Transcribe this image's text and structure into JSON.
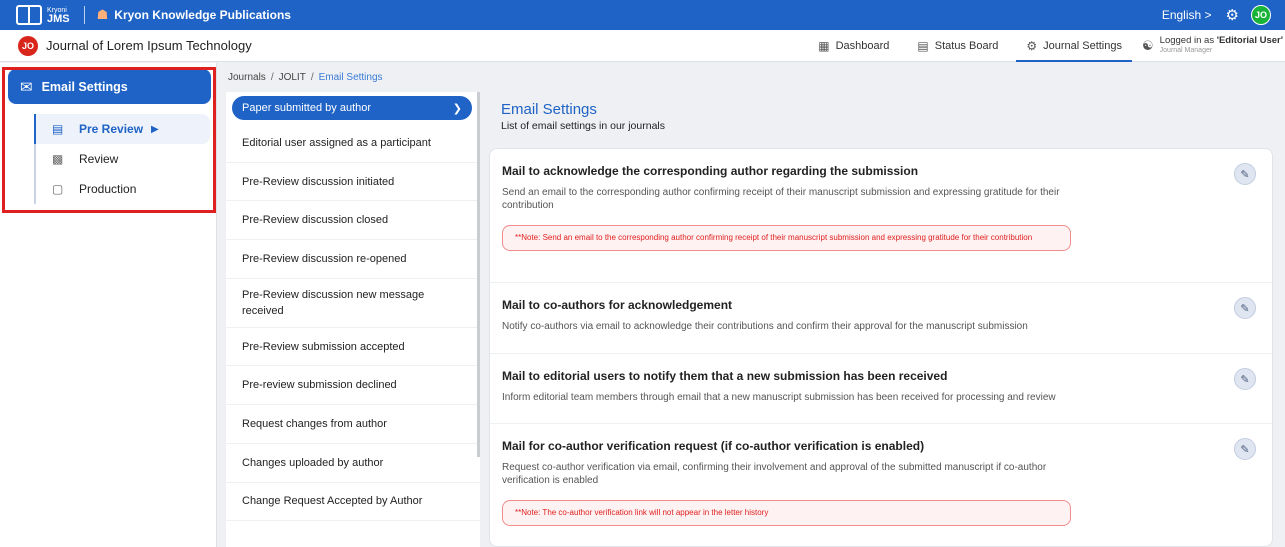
{
  "topbar": {
    "logo_small": "Kryoni",
    "logo_main": "JMS",
    "publication": "Kryon Knowledge Publications",
    "language": "English",
    "language_chevron": ">",
    "avatar_initials": "JO",
    "icons": [
      "book-logo-icon",
      "home-icon",
      "settings-gear-icon"
    ],
    "colors": {
      "bar": "#1f63c6",
      "avatar": "#19b33a",
      "home": "#ffb07a"
    }
  },
  "secbar": {
    "journal_badge": "JO",
    "journal_title": "Journal of Lorem Ipsum Technology",
    "nav": [
      {
        "label": "Dashboard",
        "icon": "grid-icon"
      },
      {
        "label": "Status Board",
        "icon": "board-icon"
      },
      {
        "label": "Journal Settings",
        "icon": "settings-icon",
        "active": true
      }
    ],
    "logged_in_prefix": "Logged in as ",
    "logged_in_role": "'Editorial User'",
    "logged_in_sub": "Journal Manager"
  },
  "sidebar": {
    "main": {
      "label": "Email Settings",
      "icon": "mail-settings-icon"
    },
    "items": [
      {
        "label": "Pre Review",
        "icon": "document-icon",
        "active": true
      },
      {
        "label": "Review",
        "icon": "review-icon"
      },
      {
        "label": "Production",
        "icon": "production-icon"
      }
    ]
  },
  "breadcrumb": {
    "items": [
      "Journals",
      "JOLIT",
      "Email Settings"
    ],
    "separator": "/"
  },
  "events": [
    "Paper submitted by author",
    "Editorial user assigned as a participant",
    "Pre-Review discussion initiated",
    "Pre-Review discussion closed",
    "Pre-Review discussion re-opened",
    "Pre-Review discussion new message received",
    "Pre-Review submission accepted",
    "Pre-review submission declined",
    "Request changes from author",
    "Changes uploaded by author",
    "Change Request Accepted by Author"
  ],
  "panel": {
    "title": "Email Settings",
    "subtitle": "List of email settings in our journals",
    "cards": [
      {
        "title": "Mail to acknowledge the corresponding author regarding the submission",
        "desc": "Send an email to the corresponding author confirming receipt of their manuscript submission and expressing gratitude for their contribution",
        "note": "**Note: Send an email to the corresponding author confirming receipt of their manuscript submission and expressing gratitude for their contribution"
      },
      {
        "title": "Mail to co-authors for acknowledgement",
        "desc": "Notify co-authors via email to acknowledge their contributions and confirm their approval for the manuscript submission"
      },
      {
        "title": "Mail to editorial users to notify them that a new submission has been received",
        "desc": "Inform editorial team members through email that a new manuscript submission has been received for processing and review"
      },
      {
        "title": "Mail for co-author verification request (if co-author verification is enabled)",
        "desc": "Request co-author verification via email, confirming their involvement and approval of the submitted manuscript if co-author verification is enabled",
        "note": "**Note: The co-author verification link will not appear in the letter history"
      }
    ]
  }
}
